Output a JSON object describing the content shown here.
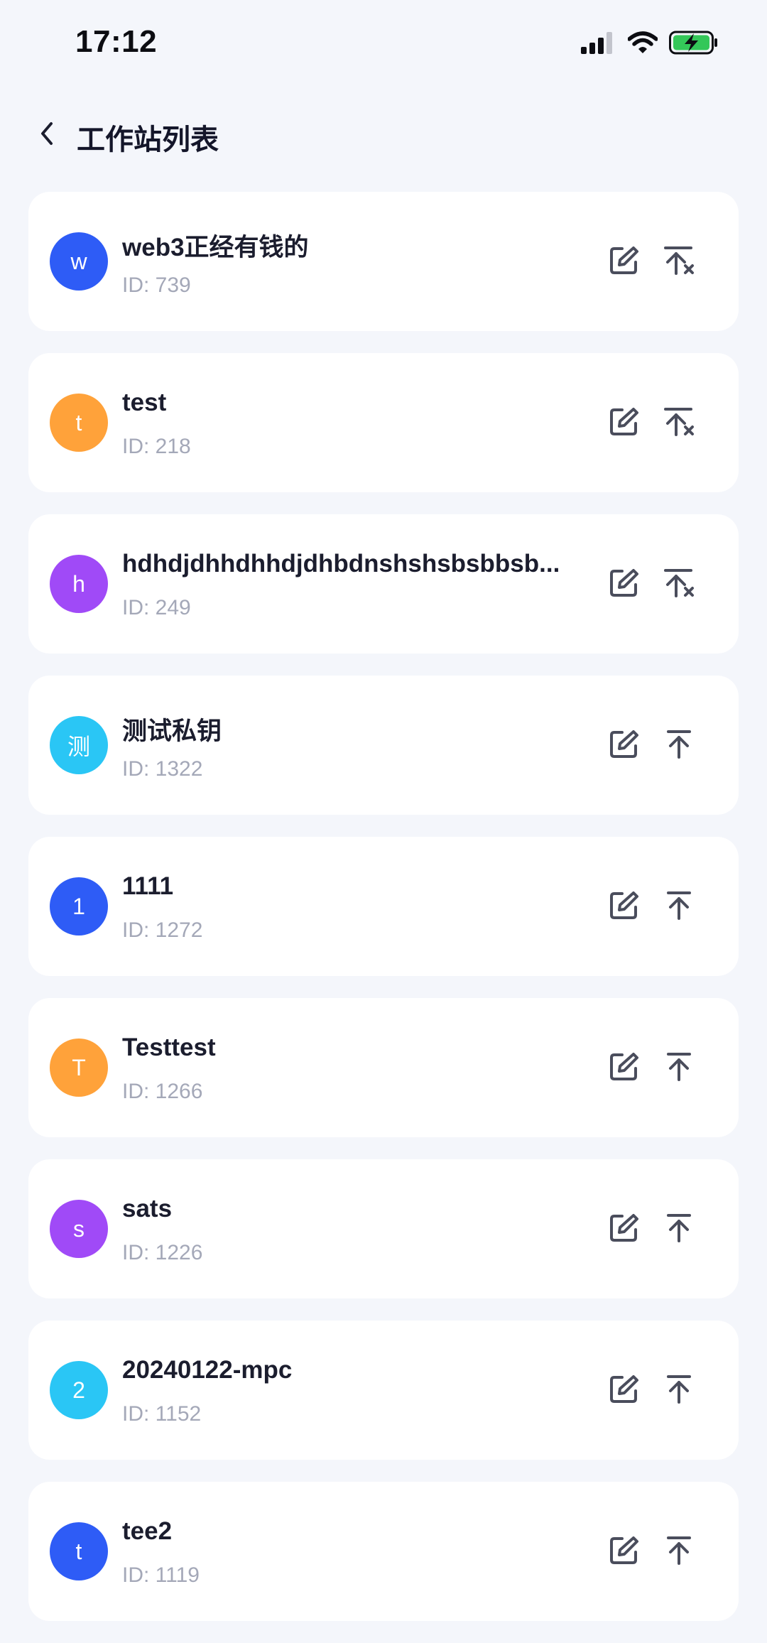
{
  "status_bar": {
    "time": "17:12",
    "signal_icon": "signal-bars-icon",
    "wifi_icon": "wifi-icon",
    "battery_icon": "battery-charging-icon",
    "battery_color": "#34c759"
  },
  "header": {
    "back_icon": "chevron-left-icon",
    "title": "工作站列表"
  },
  "colors": {
    "blue": "#2e5cf6",
    "orange": "#ffa23a",
    "purple": "#a04af7",
    "cyan": "#2ac6f5",
    "icon": "#4a4d5c"
  },
  "stations": [
    {
      "initial": "w",
      "name": "web3正经有钱的",
      "id_text": "ID: 739",
      "color": "#2e5cf6",
      "pinned": true
    },
    {
      "initial": "t",
      "name": "test",
      "id_text": "ID: 218",
      "color": "#ffa23a",
      "pinned": true
    },
    {
      "initial": "h",
      "name": "hdhdjdhhdhhdjdhbdnshshsbsbbsb...",
      "id_text": "ID: 249",
      "color": "#a04af7",
      "pinned": true
    },
    {
      "initial": "测",
      "name": "测试私钥",
      "id_text": "ID: 1322",
      "color": "#2ac6f5",
      "pinned": false
    },
    {
      "initial": "1",
      "name": "1111",
      "id_text": "ID: 1272",
      "color": "#2e5cf6",
      "pinned": false
    },
    {
      "initial": "T",
      "name": "Testtest",
      "id_text": "ID: 1266",
      "color": "#ffa23a",
      "pinned": false
    },
    {
      "initial": "s",
      "name": "sats",
      "id_text": "ID: 1226",
      "color": "#a04af7",
      "pinned": false
    },
    {
      "initial": "2",
      "name": "20240122-mpc",
      "id_text": "ID: 1152",
      "color": "#2ac6f5",
      "pinned": false
    },
    {
      "initial": "t",
      "name": "tee2",
      "id_text": "ID: 1119",
      "color": "#2e5cf6",
      "pinned": false
    }
  ]
}
